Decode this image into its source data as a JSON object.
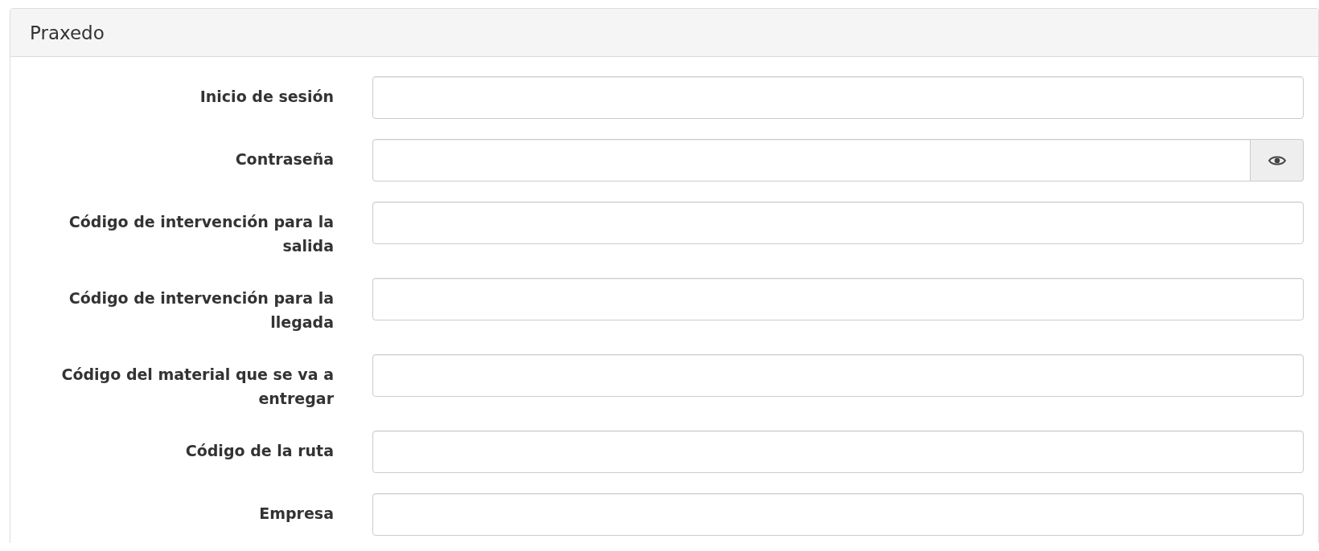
{
  "panel": {
    "title": "Praxedo"
  },
  "fields": [
    {
      "label": "Inicio de sesión",
      "kind": "text"
    },
    {
      "label": "Contraseña",
      "kind": "password"
    },
    {
      "label": "Código de intervención para la salida",
      "kind": "text"
    },
    {
      "label": "Código de intervención para la llegada",
      "kind": "text"
    },
    {
      "label": "Código del material que se va a entregar",
      "kind": "text"
    },
    {
      "label": "Código de la ruta",
      "kind": "text"
    },
    {
      "label": "Empresa",
      "kind": "text"
    }
  ]
}
